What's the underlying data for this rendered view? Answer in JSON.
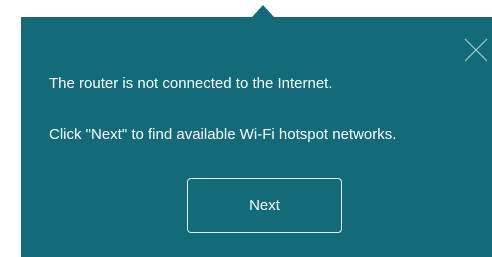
{
  "colors": {
    "panel_background": "#136b79",
    "text": "#ffffff",
    "close_icon": "#9fc9d0"
  },
  "dialog": {
    "message_line_1": "The router is not connected to the Internet.",
    "message_line_2": "Click \"Next\" to find available Wi-Fi hotspot networks.",
    "next_label": "Next",
    "close_icon": "close-icon"
  }
}
